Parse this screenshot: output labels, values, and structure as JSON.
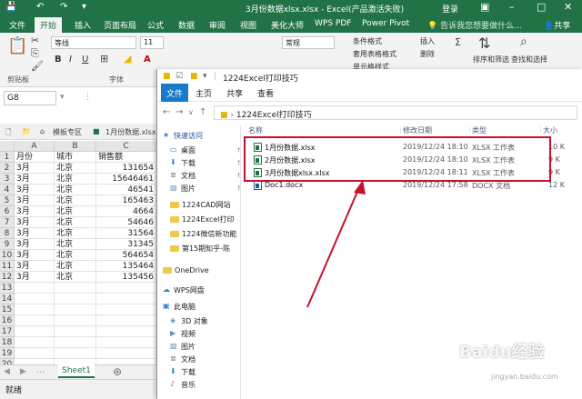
{
  "excel": {
    "window_title": "3月份数据xlsx.xlsx - Excel(产品激活失败)",
    "title_right": "登录",
    "ribbon_tabs": [
      "文件",
      "开始",
      "插入",
      "页面布局",
      "公式",
      "数据",
      "审阅",
      "视图",
      "美化大师",
      "WPS PDF",
      "Power Pivot"
    ],
    "tell_me": "告诉我您想要做什么...",
    "share": "共享",
    "ribbon": {
      "font_name": "等线",
      "font_size": "11",
      "clipboard_label": "剪贴板",
      "font_label": "字体",
      "conditional_format": "条件格式",
      "table_format": "套用表格格式",
      "cell_style": "单元格样式",
      "insert": "插入",
      "delete": "删除",
      "sort_filter": "排序和筛选",
      "find_select": "查找和选择",
      "number_format": "常规"
    },
    "name_box": "G8",
    "file_tabs": [
      "模板专区",
      "1月份数据.xlsx"
    ],
    "columns": [
      "A",
      "B",
      "C"
    ],
    "rows": [
      [
        "月份",
        "城市",
        "销售额"
      ],
      [
        "3月",
        "北京",
        "131654"
      ],
      [
        "3月",
        "北京",
        "15646461"
      ],
      [
        "3月",
        "北京",
        "46541"
      ],
      [
        "3月",
        "北京",
        "165463"
      ],
      [
        "3月",
        "北京",
        "4664"
      ],
      [
        "3月",
        "北京",
        "54646"
      ],
      [
        "3月",
        "北京",
        "31564"
      ],
      [
        "3月",
        "北京",
        "31345"
      ],
      [
        "3月",
        "北京",
        "564654"
      ],
      [
        "3月",
        "北京",
        "135464"
      ],
      [
        "3月",
        "北京",
        "135456"
      ],
      [
        "",
        "",
        ""
      ],
      [
        "",
        "",
        ""
      ],
      [
        "",
        "",
        ""
      ],
      [
        "",
        "",
        ""
      ],
      [
        "",
        "",
        ""
      ],
      [
        "",
        "",
        ""
      ],
      [
        "",
        "",
        ""
      ],
      [
        "",
        "",
        ""
      ]
    ],
    "sheet_tab": "Sheet1",
    "status": "就绪"
  },
  "explorer": {
    "title": "1224Excel打印技巧",
    "tabs": [
      "文件",
      "主页",
      "共享",
      "查看"
    ],
    "address": "1224Excel打印技巧",
    "nav": [
      {
        "label": "快速访问",
        "icon": "star-icon",
        "kind": "header"
      },
      {
        "label": "桌面",
        "icon": "desktop-icon",
        "pinned": true
      },
      {
        "label": "下载",
        "icon": "download-icon",
        "pinned": true
      },
      {
        "label": "文档",
        "icon": "document-icon",
        "pinned": true
      },
      {
        "label": "图片",
        "icon": "picture-icon",
        "pinned": true
      },
      {
        "label": "1224CAD网站",
        "icon": "folder-icon"
      },
      {
        "label": "1224Excel打印",
        "icon": "folder-icon"
      },
      {
        "label": "1224微信新功能",
        "icon": "folder-icon"
      },
      {
        "label": "第15期知乎-陈",
        "icon": "folder-icon"
      },
      {
        "label": "OneDrive",
        "icon": "folder-icon",
        "kind": "header"
      },
      {
        "label": "WPS网盘",
        "icon": "cloud-icon",
        "kind": "header"
      },
      {
        "label": "此电脑",
        "icon": "computer-icon",
        "kind": "header"
      },
      {
        "label": "3D 对象",
        "icon": "cube-icon"
      },
      {
        "label": "视频",
        "icon": "video-icon"
      },
      {
        "label": "图片",
        "icon": "picture-icon"
      },
      {
        "label": "文档",
        "icon": "document-icon"
      },
      {
        "label": "下载",
        "icon": "download-icon"
      },
      {
        "label": "音乐",
        "icon": "music-icon"
      }
    ],
    "columns": [
      "名称",
      "修改日期",
      "类型",
      "大小"
    ],
    "files": [
      {
        "name": "1月份数据.xlsx",
        "date": "2019/12/24 18:10",
        "type": "XLSX 工作表",
        "size": "10 K",
        "icon": "xlsx-icon"
      },
      {
        "name": "2月份数据.xlsx",
        "date": "2019/12/24 18:10",
        "type": "XLSX 工作表",
        "size": "9 K",
        "icon": "xlsx-icon"
      },
      {
        "name": "3月份数据xlsx.xlsx",
        "date": "2019/12/24 18:11",
        "type": "XLSX 工作表",
        "size": "9 K",
        "icon": "xlsx-icon"
      },
      {
        "name": "Doc1.docx",
        "date": "2019/12/24 17:58",
        "type": "DOCX 文档",
        "size": "12 K",
        "icon": "docx-icon"
      }
    ]
  },
  "colors": {
    "excel_green": "#217346",
    "highlight_red": "#c8102e",
    "explorer_blue": "#1979ca"
  },
  "watermark": {
    "logo": "Baidu经验",
    "url": "jingyan.baidu.com"
  }
}
